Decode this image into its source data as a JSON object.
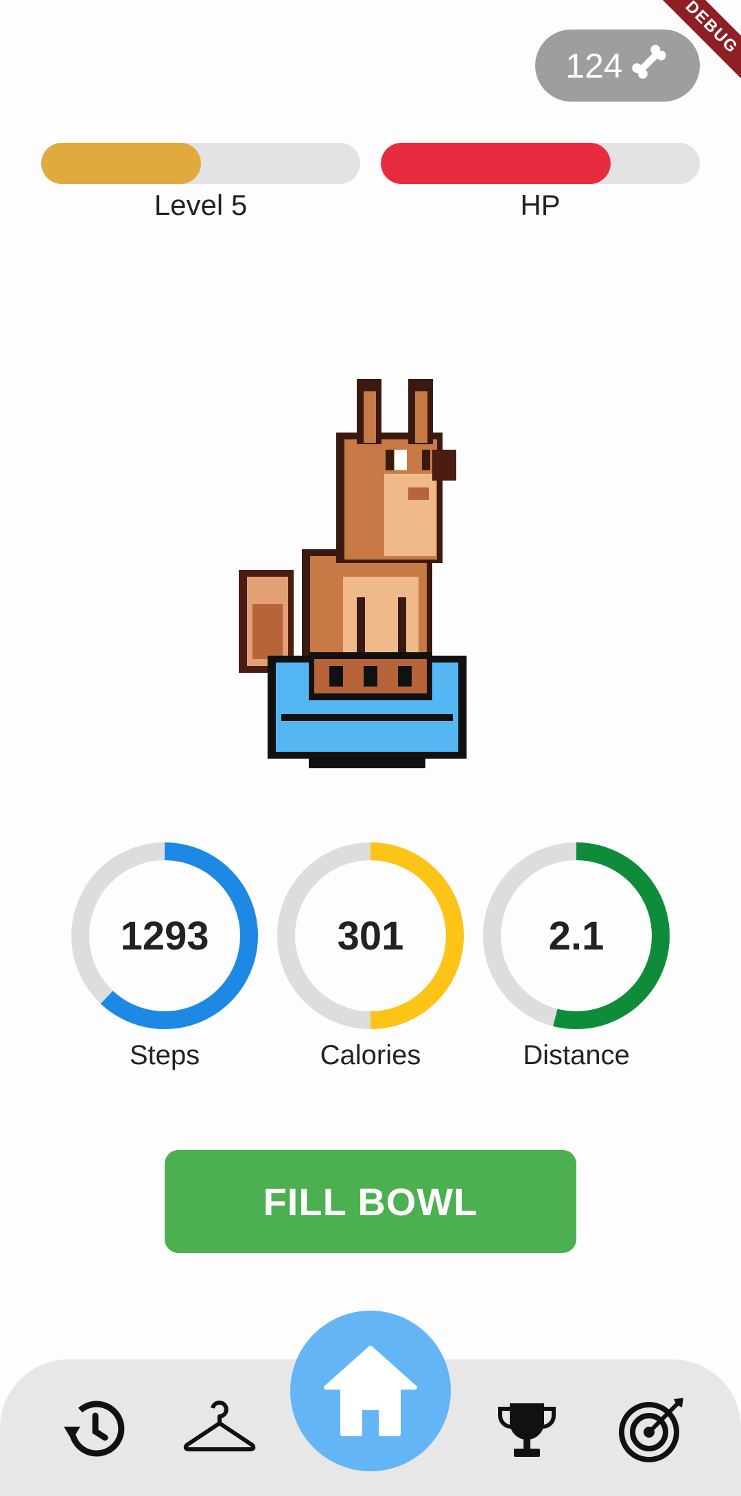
{
  "app": {
    "debug_banner": "DEBUG"
  },
  "currency": {
    "bones": "124",
    "icon": "bone-icon"
  },
  "status_bars": {
    "level": {
      "label": "Level 5",
      "fraction": 0.5,
      "color": "#e0aa3e"
    },
    "hp": {
      "label": "HP",
      "fraction": 0.72,
      "color": "#e82c40"
    }
  },
  "pet": {
    "icon": "pixel-dog-with-bowl"
  },
  "stats": [
    {
      "value": "1293",
      "label": "Steps",
      "progress": 0.62,
      "color": "#1e88e5"
    },
    {
      "value": "301",
      "label": "Calories",
      "progress": 0.5,
      "color": "#fbc417"
    },
    {
      "value": "2.1",
      "label": "Distance",
      "progress": 0.54,
      "color": "#0e8c3a"
    }
  ],
  "actions": {
    "fill_bowl": "FILL BOWL"
  },
  "nav": {
    "items": [
      "history-icon",
      "hanger-icon",
      "home-icon",
      "trophy-icon",
      "target-icon"
    ],
    "active": "home-icon"
  }
}
